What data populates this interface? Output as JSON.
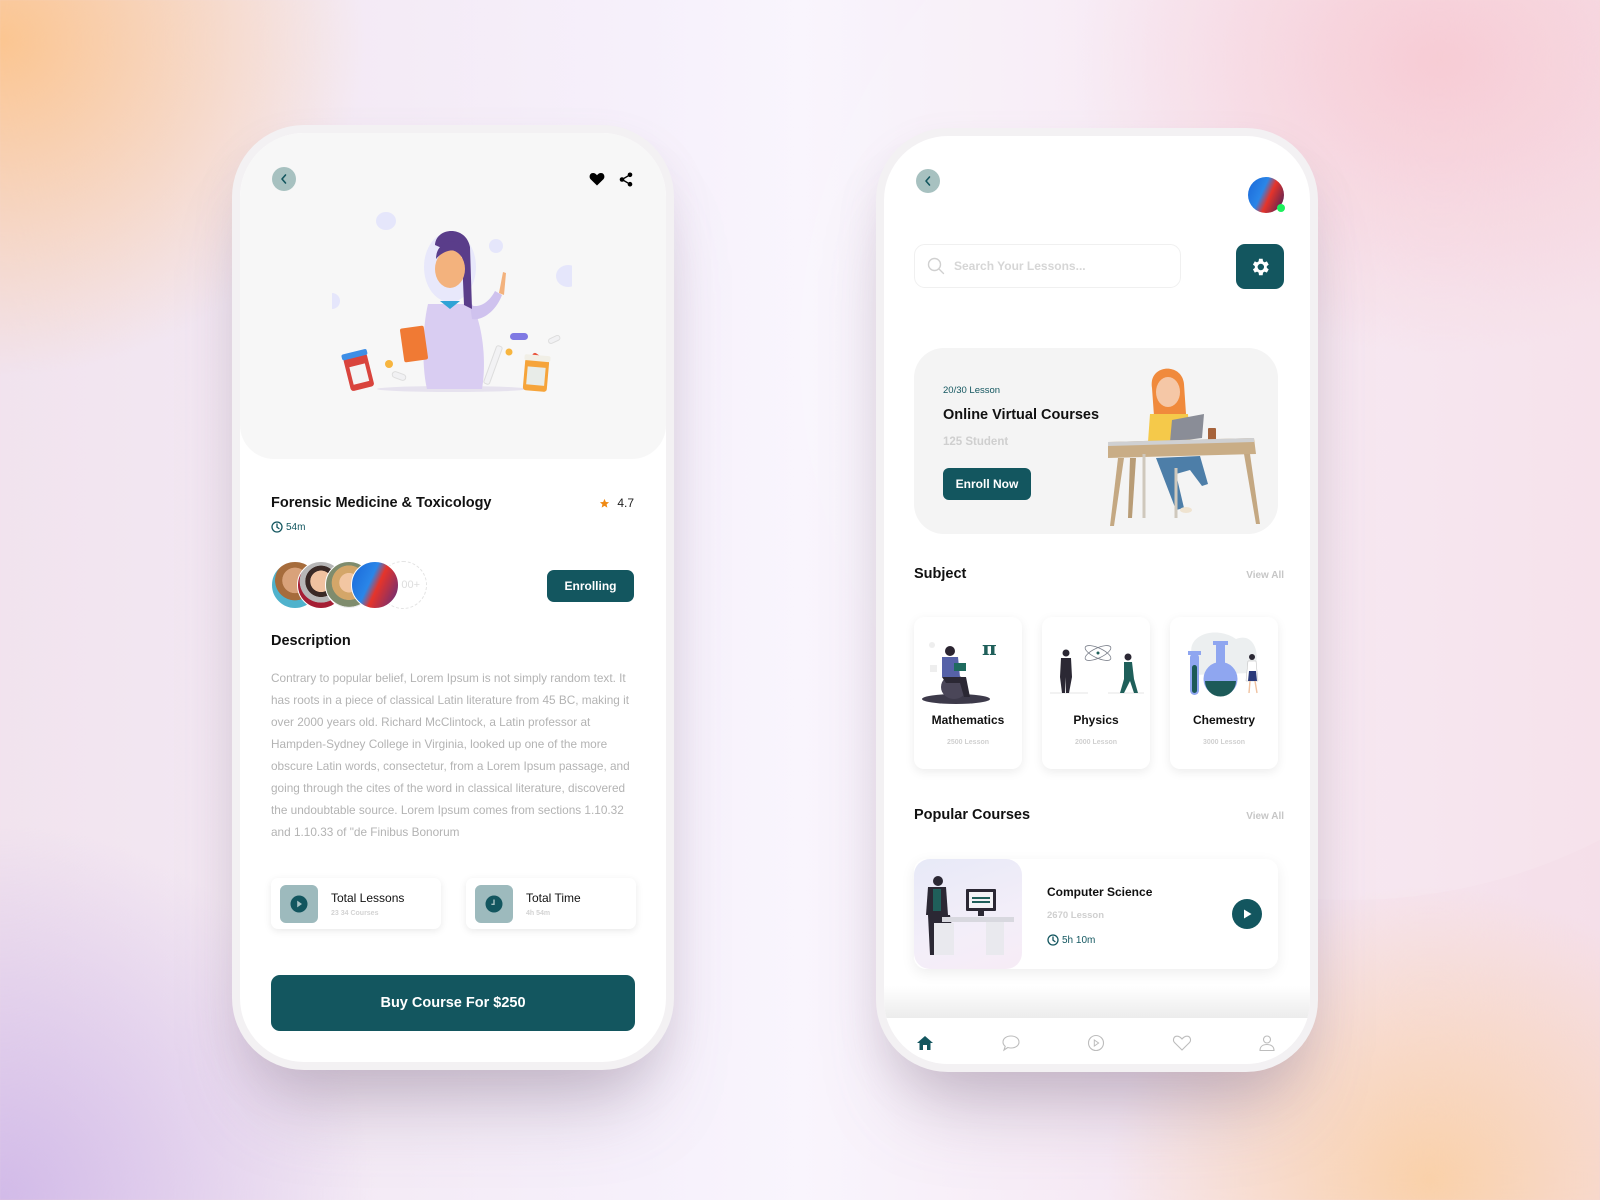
{
  "colors": {
    "primary": "#13565f",
    "back_button_bg": "#a7c1c0",
    "star": "#f08a14",
    "online": "#1cf05c",
    "muted_text": "#b3b3b3"
  },
  "course_detail": {
    "back_icon": "chevron-left-icon",
    "favorite_icon": "heart-icon",
    "share_icon": "share-icon",
    "hero_illustration": "doctor-with-medicine-illustration",
    "title": "Forensic Medicine & Toxicology",
    "rating": "4.7",
    "rating_icon": "star-icon",
    "duration": "54m",
    "enrolled_more": "00+",
    "enroll_status": "Enrolling",
    "description_heading": "Description",
    "description": "Contrary to popular belief, Lorem Ipsum is not simply random text. It has roots in a piece of classical Latin literature from 45 BC, making it over 2000 years old. Richard McClintock, a Latin professor at Hampden-Sydney College in Virginia, looked up one of the more obscure Latin words, consectetur, from a Lorem Ipsum passage, and going through the cites of the word in classical literature, discovered the undoubtable source. Lorem Ipsum comes from sections 1.10.32 and 1.10.33 of \"de Finibus Bonorum",
    "stats": [
      {
        "label": "Total Lessons",
        "value": "23 34 Courses",
        "icon": "play-icon"
      },
      {
        "label": "Total Time",
        "value": "4h 54m",
        "icon": "clock-icon"
      }
    ],
    "buy_button": "Buy Course For $250"
  },
  "home": {
    "back_icon": "chevron-left-icon",
    "profile_online": true,
    "search": {
      "placeholder": "Search Your Lessons...",
      "value": ""
    },
    "settings_icon": "gear-icon",
    "promo": {
      "progress": "20/30 Lesson",
      "title": "Online Virtual Courses",
      "students": "125 Student",
      "button": "Enroll Now"
    },
    "subject_heading": "Subject",
    "subject_view_all": "View All",
    "subjects": [
      {
        "name": "Mathematics",
        "lessons": "2500 Lesson"
      },
      {
        "name": "Physics",
        "lessons": "2000 Lesson"
      },
      {
        "name": "Chemestry",
        "lessons": "3000 Lesson"
      }
    ],
    "popular_heading": "Popular Courses",
    "popular_view_all": "View All",
    "popular": [
      {
        "title": "Computer Science",
        "lessons": "2670 Lesson",
        "duration": "5h 10m"
      }
    ],
    "tabs": [
      {
        "name": "home",
        "icon": "home-icon",
        "active": true
      },
      {
        "name": "chat",
        "icon": "chat-bubble-icon",
        "active": false
      },
      {
        "name": "videos",
        "icon": "play-circle-icon",
        "active": false
      },
      {
        "name": "favorites",
        "icon": "heart-outline-icon",
        "active": false
      },
      {
        "name": "profile",
        "icon": "user-icon",
        "active": false
      }
    ]
  }
}
